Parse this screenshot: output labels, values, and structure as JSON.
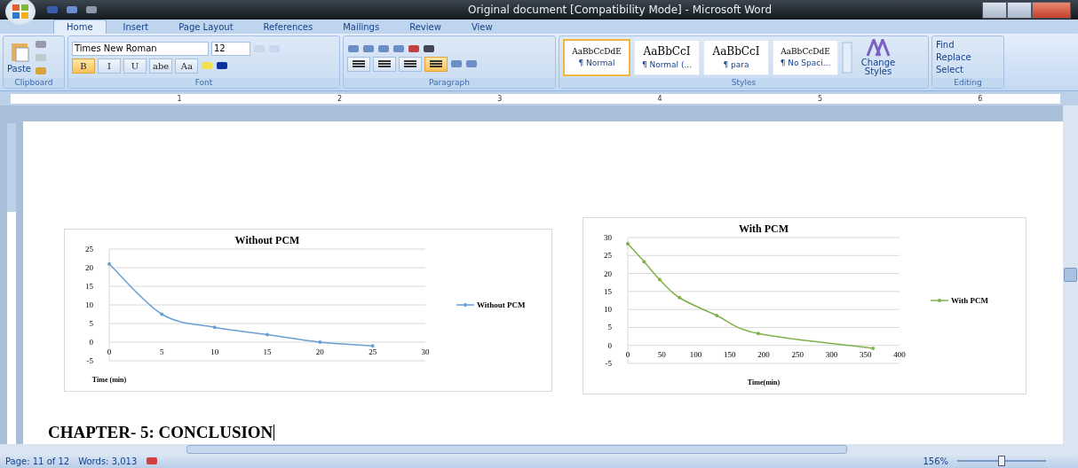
{
  "window": {
    "title": "Original document [Compatibility Mode] - Microsoft Word"
  },
  "tabs": [
    {
      "label": "Home",
      "selected": true
    },
    {
      "label": "Insert",
      "selected": false
    },
    {
      "label": "Page Layout",
      "selected": false
    },
    {
      "label": "References",
      "selected": false
    },
    {
      "label": "Mailings",
      "selected": false
    },
    {
      "label": "Review",
      "selected": false
    },
    {
      "label": "View",
      "selected": false
    }
  ],
  "clipboard": {
    "paste": "Paste",
    "group": "Clipboard"
  },
  "font": {
    "name": "Times New Roman",
    "size": "12",
    "group": "Font",
    "format_buttons": [
      {
        "label": "B",
        "selected": true
      },
      {
        "label": "I",
        "selected": false
      },
      {
        "label": "U",
        "selected": false
      },
      {
        "label": "abe",
        "selected": false
      },
      {
        "label": "Aa",
        "selected": false
      }
    ]
  },
  "paragraph": {
    "group": "Paragraph",
    "align_buttons": [
      {
        "selected": false
      },
      {
        "selected": false
      },
      {
        "selected": false
      },
      {
        "selected": true
      }
    ]
  },
  "styles": {
    "group": "Styles",
    "items": [
      {
        "preview": "AaBbCcDdE",
        "name": "¶ Normal",
        "selected": true
      },
      {
        "preview": "AaBbCcI",
        "name": "¶ Normal (...",
        "selected": false
      },
      {
        "preview": "AaBbCcI",
        "name": "¶ para",
        "selected": false
      },
      {
        "preview": "AaBbCcDdE",
        "name": "¶ No Spaci...",
        "selected": false
      }
    ],
    "change": "Change Styles"
  },
  "editing": {
    "group": "Editing",
    "items": [
      "Find",
      "Replace",
      "Select"
    ]
  },
  "ruler": {
    "labels": [
      "1",
      "2",
      "3",
      "4",
      "5",
      "6"
    ]
  },
  "charts": [
    {
      "chart_data": {
        "type": "line",
        "title": "Without PCM",
        "xlabel": "Time (min)",
        "x": [
          0,
          5,
          10,
          15,
          20,
          25
        ],
        "series": [
          {
            "name": "Without PCM",
            "color": "#6a9fd4",
            "values": [
              21,
              7.5,
              4,
              2,
              0,
              -1
            ]
          }
        ],
        "xlim": [
          0,
          30
        ],
        "ylim": [
          -5,
          25
        ],
        "xticks": [
          0,
          5,
          10,
          15,
          20,
          25,
          30
        ],
        "yticks": [
          25,
          20,
          15,
          10,
          5,
          0,
          -5
        ],
        "grid": true
      }
    },
    {
      "chart_data": {
        "type": "line",
        "title": "With PCM",
        "xlabel": "Time(min)",
        "x": [
          0,
          24,
          47,
          76,
          131,
          192,
          361
        ],
        "series": [
          {
            "name": "With PCM",
            "color": "#7fb24a",
            "values": [
              28.3,
              23.3,
              18.3,
              13.3,
              8.3,
              3.3,
              -0.8
            ]
          }
        ],
        "xlim": [
          0,
          400
        ],
        "ylim": [
          -5,
          30
        ],
        "xticks": [
          0,
          50,
          100,
          150,
          200,
          250,
          300,
          350,
          400
        ],
        "yticks": [
          30,
          25,
          20,
          15,
          10,
          5,
          0,
          -5
        ],
        "grid": true
      }
    }
  ],
  "heading": "CHAPTER- 5: CONCLUSION",
  "status": {
    "page": "Page: 11 of 12",
    "words": "Words: 3,013",
    "zoom": "156%",
    "zoom_slider": {
      "level": 0.5
    }
  }
}
